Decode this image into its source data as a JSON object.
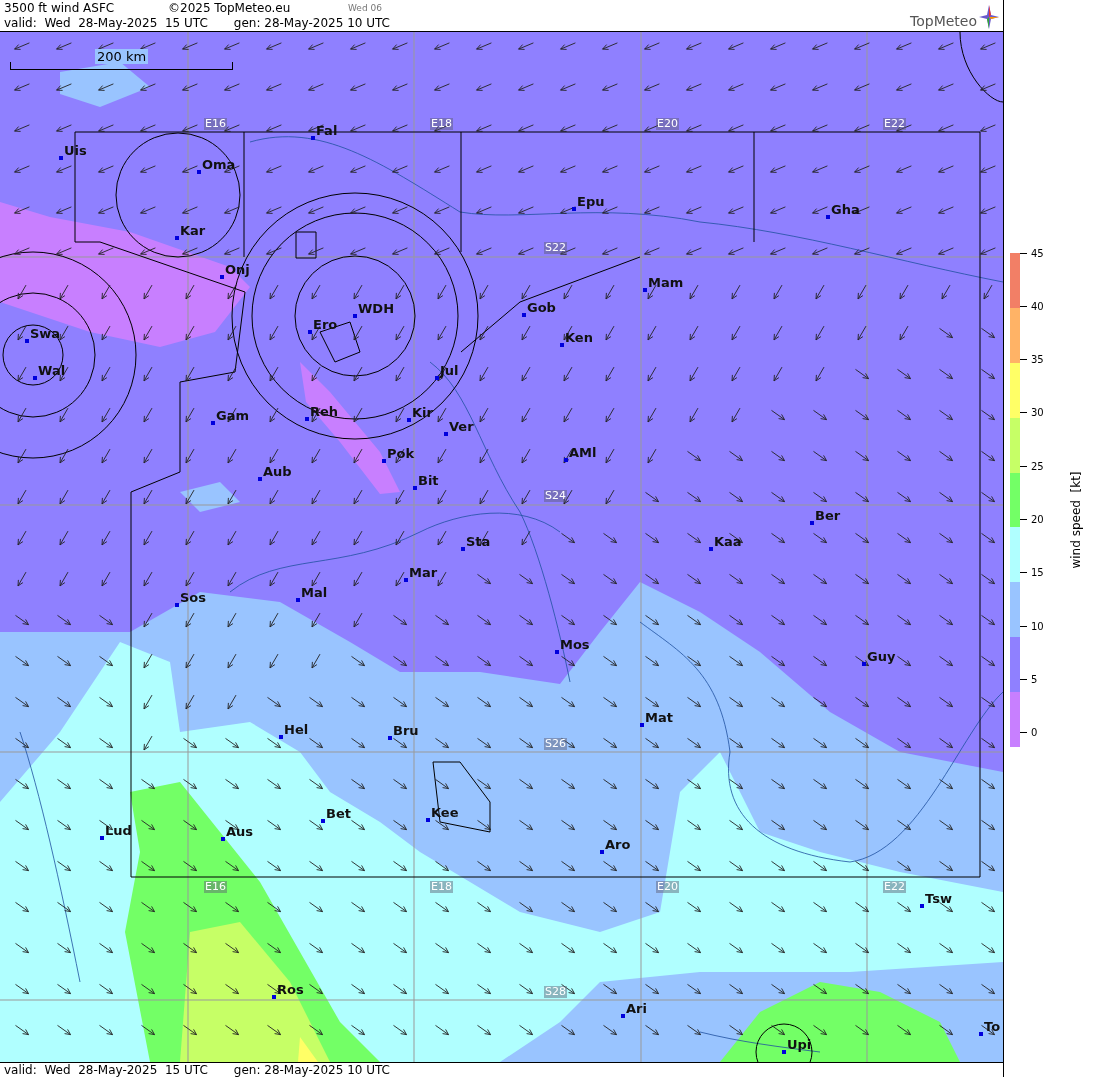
{
  "header": {
    "title": "3500 ft wind ASFC",
    "copyright": "©2025 TopMeteo.eu",
    "day_tab": "Wed 06",
    "valid": "valid:  Wed  28-May-2025  15 UTC",
    "generated": "gen: 28-May-2025 10 UTC",
    "logo": "TopMeteo"
  },
  "map": {
    "scale": "200 km",
    "grid_labels": [
      "E16",
      "E18",
      "E20",
      "E22",
      "S22",
      "S24",
      "S26",
      "S28",
      "E16",
      "E18",
      "E20",
      "E22"
    ],
    "places": [
      "Uis",
      "Oma",
      "Fal",
      "Kar",
      "Onj",
      "Epu",
      "Gha",
      "Mam",
      "Gob",
      "Ken",
      "WDH",
      "Ero",
      "Swa",
      "Wal",
      "Jul",
      "Gam",
      "Reh",
      "Kir",
      "Ver",
      "Pok",
      "AMl",
      "Aub",
      "Bit",
      "Ber",
      "Sta",
      "Kaa",
      "Mar",
      "Sos",
      "Mal",
      "Mos",
      "Guy",
      "Mat",
      "Hel",
      "Bru",
      "Bet",
      "Kee",
      "Lud",
      "Aus",
      "Aro",
      "Tsw",
      "Ros",
      "Ari",
      "Upi",
      "To"
    ]
  },
  "legend": {
    "title": "wind speed  [kt]",
    "ticks": [
      "45",
      "40",
      "35",
      "30",
      "25",
      "20",
      "15",
      "10",
      "5",
      "0"
    ],
    "bands": [
      {
        "color": "#f27f66"
      },
      {
        "color": "#ffb366"
      },
      {
        "color": "#ffff66"
      },
      {
        "color": "#c6ff66"
      },
      {
        "color": "#73ff66"
      },
      {
        "color": "#b0ffff"
      },
      {
        "color": "#99c4ff"
      },
      {
        "color": "#8f80ff"
      },
      {
        "color": "#c87fff"
      }
    ]
  },
  "footer": {
    "valid": "valid:  Wed  28-May-2025  15 UTC",
    "generated": "gen: 28-May-2025 10 UTC"
  }
}
